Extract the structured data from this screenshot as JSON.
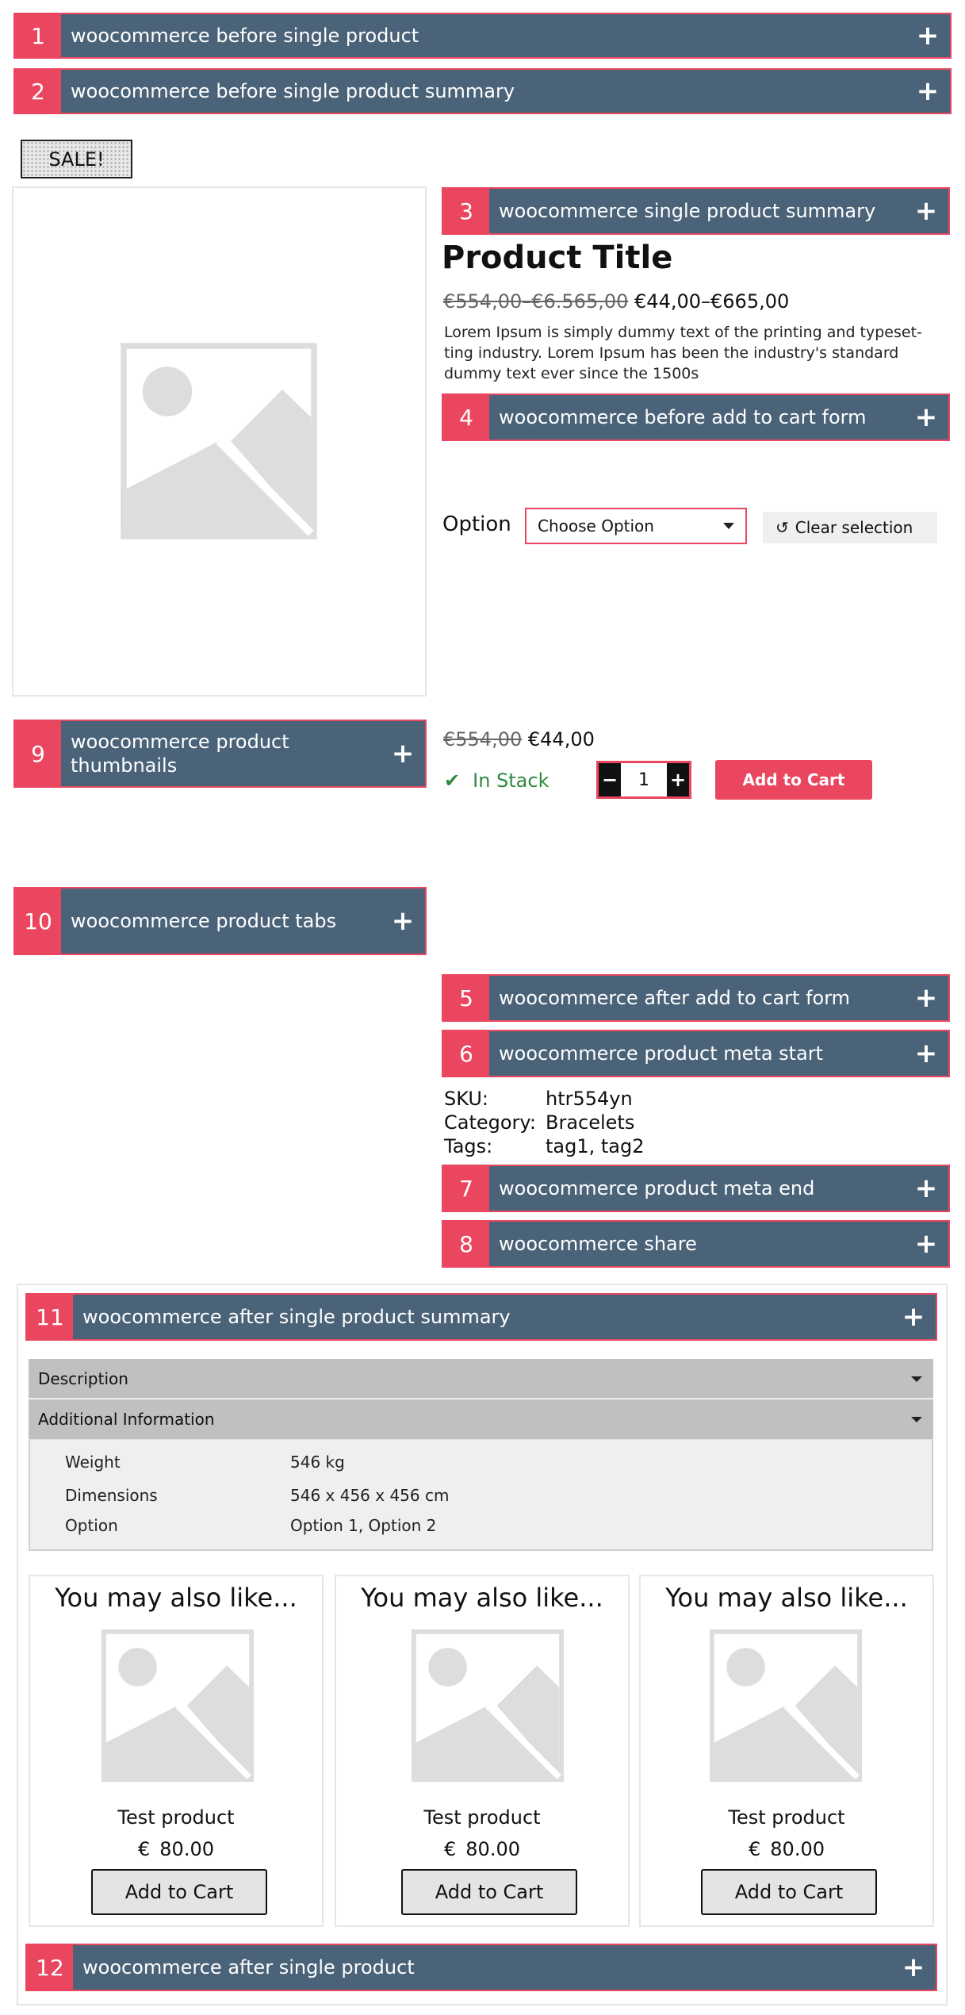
{
  "hooks": [
    {
      "num": "1",
      "label": "woocommerce before single product"
    },
    {
      "num": "2",
      "label": "woocommerce before single product summary"
    },
    {
      "num": "3",
      "label": "woocommerce single product summary"
    },
    {
      "num": "4",
      "label": "woocommerce before add to cart form"
    },
    {
      "num": "5",
      "label": "woocommerce after add to cart form"
    },
    {
      "num": "6",
      "label": "woocommerce product meta start"
    },
    {
      "num": "7",
      "label": "woocommerce product meta end"
    },
    {
      "num": "8",
      "label": "woocommerce share"
    },
    {
      "num": "9",
      "label": "woocommerce product thumbnails"
    },
    {
      "num": "10",
      "label": "woocommerce product tabs"
    },
    {
      "num": "11",
      "label": "woocommerce after single product summary"
    },
    {
      "num": "12",
      "label": "woocommerce after single product"
    }
  ],
  "hook_action_icon": "plus-icon",
  "sale_badge": "SALE!",
  "product": {
    "title": "Product Title",
    "price_range_old": "€554,00–€6.565,00",
    "price_range_new": "€44,00–€665,00",
    "description": "Lorem Ipsum is simply dummy text of the printing and typeset-ting industry. Lorem Ipsum has been the industry's standard dummy text ever since the 1500s"
  },
  "variation": {
    "label": "Option",
    "select_value": "Choose Option",
    "clear_label": "Clear selection",
    "clear_icon": "reset-icon"
  },
  "variation_price": {
    "old": "€554,00",
    "new": "€44,00"
  },
  "stock": {
    "text": "In Stack",
    "icon": "check-icon"
  },
  "quantity": {
    "minus": "−",
    "value": "1",
    "plus": "+"
  },
  "add_to_cart_label": "Add to Cart",
  "meta": [
    {
      "key": "SKU:",
      "value": "htr554yn"
    },
    {
      "key": "Category:",
      "value": "Bracelets"
    },
    {
      "key": "Tags:",
      "value": "tag1, tag2"
    }
  ],
  "tabs": {
    "description_label": "Description",
    "additional_label": "Additional Information",
    "attributes": [
      {
        "name": "Weight",
        "value": "546 kg"
      },
      {
        "name": "Dimensions",
        "value": "546 x 456 x 456 cm"
      },
      {
        "name": "Option",
        "value": "Option 1, Option 2"
      }
    ]
  },
  "related": [
    {
      "heading": "You may also like...",
      "name": "Test product",
      "currency": "€",
      "price": "80.00",
      "button": "Add to Cart"
    },
    {
      "heading": "You may also like...",
      "name": "Test product",
      "currency": "€",
      "price": "80.00",
      "button": "Add to Cart"
    },
    {
      "heading": "You may also like...",
      "name": "Test product",
      "currency": "€",
      "price": "80.00",
      "button": "Add to Cart"
    }
  ],
  "colors": {
    "hook_accent": "#ea4660",
    "hook_bg": "#4a6378",
    "stock_green": "#2e8b3e"
  }
}
